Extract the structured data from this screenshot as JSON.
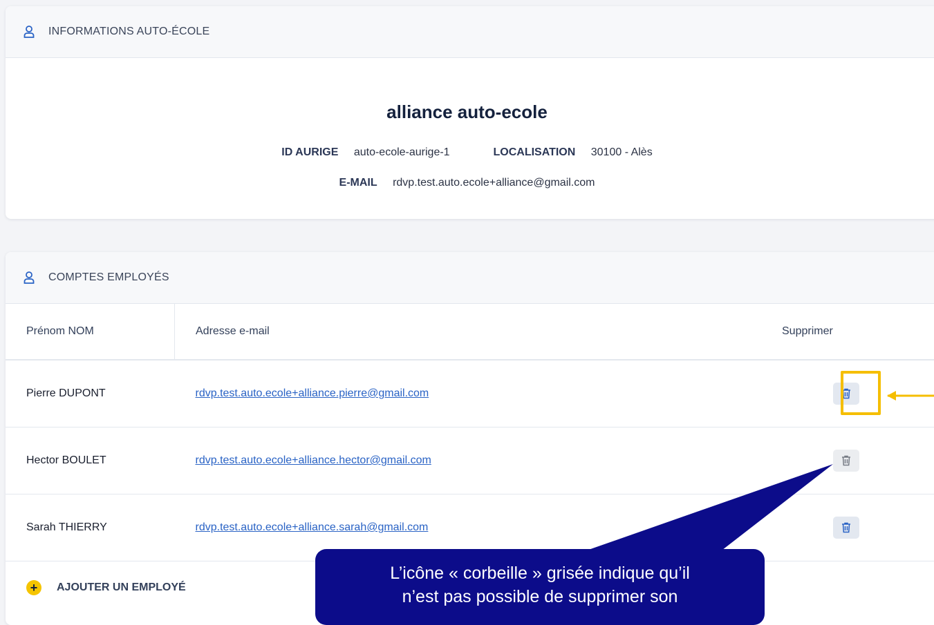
{
  "school_info": {
    "header": "INFORMATIONS AUTO-ÉCOLE",
    "name": "alliance auto-ecole",
    "id_label": "ID AURIGE",
    "id_value": "auto-ecole-aurige-1",
    "location_label": "LOCALISATION",
    "location_value": "30100 - Alès",
    "email_label": "E-MAIL",
    "email_value": "rdvp.test.auto.ecole+alliance@gmail.com"
  },
  "employees": {
    "header": "COMPTES EMPLOYÉS",
    "columns": [
      "Prénom NOM",
      "Adresse e-mail",
      "Supprimer"
    ],
    "rows": [
      {
        "name": "Pierre DUPONT",
        "email": "rdvp.test.auto.ecole+alliance.pierre@gmail.com",
        "delete_enabled": true
      },
      {
        "name": "Hector BOULET",
        "email": "rdvp.test.auto.ecole+alliance.hector@gmail.com",
        "delete_enabled": false
      },
      {
        "name": "Sarah THIERRY",
        "email": "rdvp.test.auto.ecole+alliance.sarah@gmail.com",
        "delete_enabled": true
      }
    ],
    "add_label": "AJOUTER UN EMPLOYÉ"
  },
  "callout": {
    "line1": "L’icône « corbeille » grisée indique qu’il",
    "line2": "n’est pas possible de supprimer son"
  },
  "colors": {
    "accent_blue": "#2a63c5",
    "highlight_yellow": "#f5be00",
    "callout_navy": "#0c0c8a"
  }
}
